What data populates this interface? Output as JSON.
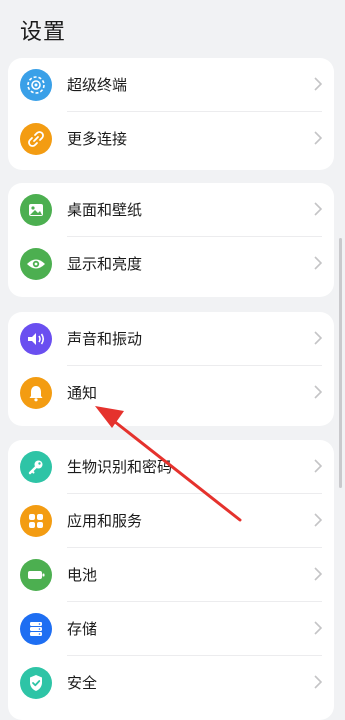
{
  "page": {
    "title": "设置"
  },
  "colors": {
    "background": "#f1f2f4",
    "card": "#ffffff",
    "annotation_arrow": "#e5322d"
  },
  "groups": [
    {
      "items": [
        {
          "label": "超级终端",
          "icon": "super-device-icon",
          "color": "#3aa0e8"
        },
        {
          "label": "更多连接",
          "icon": "link-icon",
          "color": "#f39c12"
        }
      ]
    },
    {
      "items": [
        {
          "label": "桌面和壁纸",
          "icon": "wallpaper-icon",
          "color": "#4caf50"
        },
        {
          "label": "显示和亮度",
          "icon": "eye-icon",
          "color": "#4caf50"
        }
      ]
    },
    {
      "items": [
        {
          "label": "声音和振动",
          "icon": "speaker-icon",
          "color": "#6a4ff0"
        },
        {
          "label": "通知",
          "icon": "bell-icon",
          "color": "#f39c12"
        }
      ]
    },
    {
      "items": [
        {
          "label": "生物识别和密码",
          "icon": "key-icon",
          "color": "#2ec4a6"
        },
        {
          "label": "应用和服务",
          "icon": "apps-icon",
          "color": "#f39c12"
        },
        {
          "label": "电池",
          "icon": "battery-icon",
          "color": "#4caf50"
        },
        {
          "label": "存储",
          "icon": "storage-icon",
          "color": "#1e6ef2"
        },
        {
          "label": "安全",
          "icon": "shield-icon",
          "color": "#2ec4a6"
        }
      ]
    }
  ]
}
